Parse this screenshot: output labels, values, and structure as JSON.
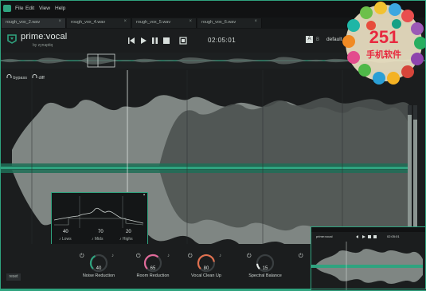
{
  "menubar": {
    "items": [
      "File",
      "Edit",
      "View",
      "Help"
    ]
  },
  "tabs": [
    {
      "label": "rough_vox_2.wav",
      "active": true
    },
    {
      "label": "rough_vox_4.wav",
      "active": false
    },
    {
      "label": "rough_vox_5.wav",
      "active": false
    },
    {
      "label": "rough_vox_6.wav",
      "active": false
    }
  ],
  "header": {
    "product": "prime:vocal",
    "by": "by zynaptiq",
    "time": "02:05:01",
    "ab_a": "A",
    "ab_b": "B",
    "preset": "default"
  },
  "toggles": {
    "bypass": "bypass",
    "diff": "diff"
  },
  "popup": {
    "lows_value": "40",
    "mids_value": "70",
    "highs_value": "20",
    "lows_label": "Lows",
    "mids_label": "Mids",
    "highs_label": "Highs"
  },
  "knobs": [
    {
      "label": "Noise Reduction",
      "value": "40",
      "color": "#2fa37f"
    },
    {
      "label": "Room Reduction",
      "value": "65",
      "color": "#e06a9a"
    },
    {
      "label": "Vocal Clean Up",
      "value": "80",
      "color": "#e0704f"
    },
    {
      "label": "Spectral Balance",
      "value": "15",
      "color": "#e8ecea"
    }
  ],
  "reset": "reset",
  "colors": {
    "accent": "#2fa37f",
    "background": "#1b1d1e",
    "waveform": "#7f8683",
    "waveform_dark": "#4a4f4e"
  },
  "meters": {
    "left": 0.93,
    "right": 0.9
  },
  "thumbnail": {
    "product": "prime:vocal",
    "time": "02:05:01"
  },
  "badge": {
    "number": "251",
    "text": "手机软件"
  }
}
